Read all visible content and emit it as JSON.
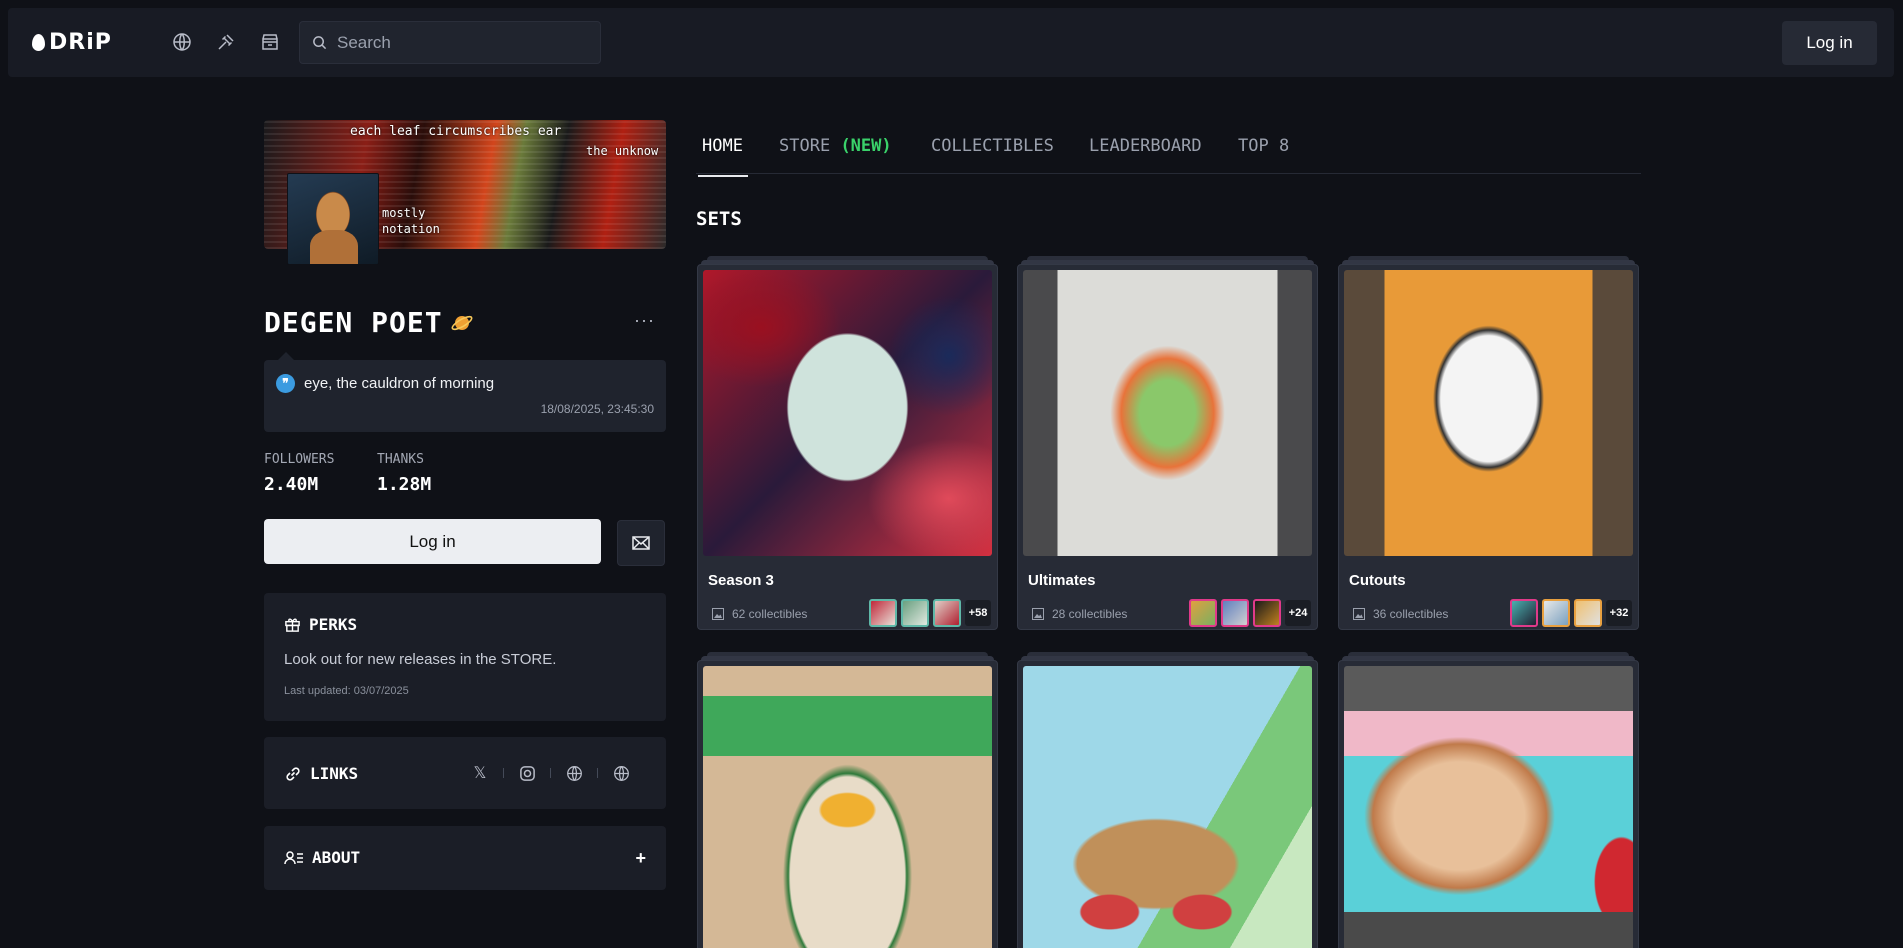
{
  "header": {
    "logo_text": "DRiP",
    "search_placeholder": "Search",
    "login_label": "Log in",
    "nav_icons": [
      "globe-icon",
      "gavel-icon",
      "store-icon"
    ]
  },
  "profile": {
    "banner_lines": [
      "each leaf circumscribes ear",
      "the unknow",
      "mostly",
      "notation"
    ],
    "name": "DEGEN POET",
    "more": "···",
    "status": {
      "text": "eye, the cauldron of morning",
      "timestamp": "18/08/2025, 23:45:30"
    },
    "followers_label": "FOLLOWERS",
    "followers_value": "2.40M",
    "thanks_label": "THANKS",
    "thanks_value": "1.28M",
    "login_label": "Log in"
  },
  "perks": {
    "title": "PERKS",
    "text": "Look out for new releases in the STORE.",
    "updated": "Last updated: 03/07/2025"
  },
  "links": {
    "title": "LINKS",
    "icons": [
      "x-icon",
      "instagram-icon",
      "globe-icon",
      "globe-icon"
    ]
  },
  "about": {
    "title": "ABOUT",
    "toggle": "+"
  },
  "tabs": [
    {
      "label": "HOME",
      "active": true
    },
    {
      "label": "STORE",
      "badge": "(NEW)"
    },
    {
      "label": "COLLECTIBLES"
    },
    {
      "label": "LEADERBOARD"
    },
    {
      "label": "TOP 8"
    }
  ],
  "sets_title": "SETS",
  "sets": [
    {
      "name": "Season 3",
      "count": "62 collectibles",
      "more": "+58"
    },
    {
      "name": "Ultimates",
      "count": "28 collectibles",
      "more": "+24"
    },
    {
      "name": "Cutouts",
      "count": "36 collectibles",
      "more": "+32"
    }
  ],
  "colors": {
    "new_badge": "#3ad16a",
    "background": "#0f1117"
  }
}
